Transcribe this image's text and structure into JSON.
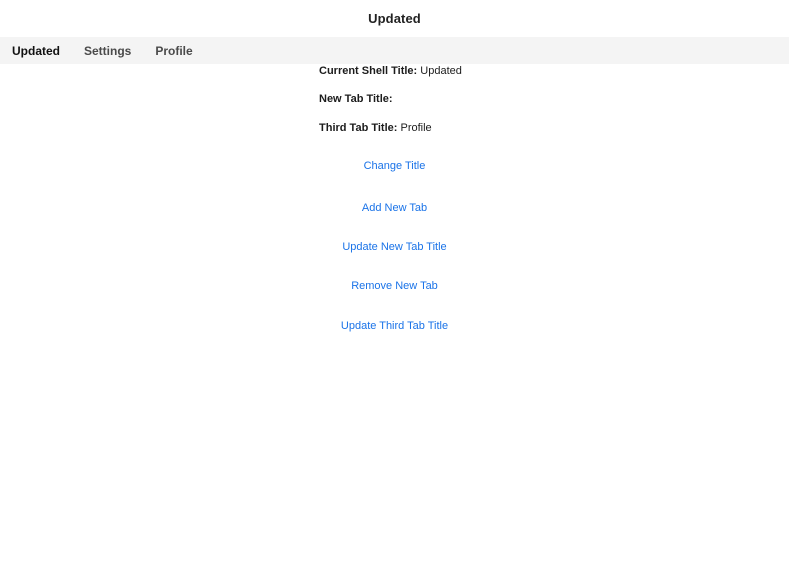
{
  "window": {
    "title": "Updated"
  },
  "tabs": [
    {
      "label": "Updated",
      "active": true
    },
    {
      "label": "Settings",
      "active": false
    },
    {
      "label": "Profile",
      "active": false
    }
  ],
  "info": {
    "shell_title_label": "Current Shell Title:",
    "shell_title_value": "Updated",
    "new_tab_title_label": "New Tab Title:",
    "new_tab_title_value": "",
    "third_tab_title_label": "Third Tab Title:",
    "third_tab_title_value": "Profile"
  },
  "actions": {
    "change_title": "Change Title",
    "add_new_tab": "Add New Tab",
    "update_new_tab_title": "Update New Tab Title",
    "remove_new_tab": "Remove New Tab",
    "update_third_tab_title": "Update Third Tab Title"
  },
  "colors": {
    "link": "#1a73e8",
    "tabbar_bg": "#f4f4f4"
  }
}
